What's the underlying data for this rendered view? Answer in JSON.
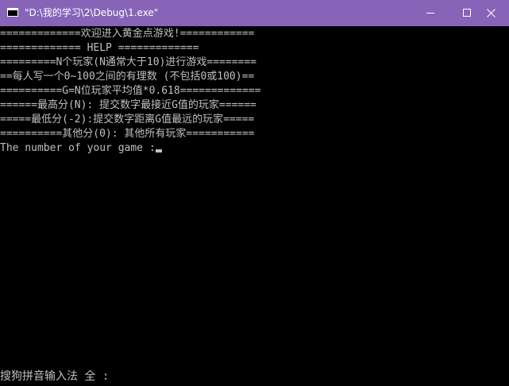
{
  "window": {
    "title": "\"D:\\我的学习\\2\\Debug\\1.exe\"",
    "controls": {
      "minimize": "minimize",
      "maximize": "maximize",
      "close": "close"
    },
    "colors": {
      "titlebar": "#8764b8",
      "console_background": "#000000",
      "console_text": "#c0c0c0"
    }
  },
  "console": {
    "lines": [
      "=============欢迎进入黄金点游戏!============",
      "============= HELP =============",
      "=========N个玩家(N通常大于10)进行游戏========",
      "==每人写一个0~100之间的有理数 (不包括0或100)==",
      "==========G=N位玩家平均值*0.618=============",
      "======最高分(N): 提交数字最接近G值的玩家======",
      "=====最低分(-2):提交数字距离G值最远的玩家=====",
      "==========其他分(0): 其他所有玩家===========",
      "The number of your game :"
    ]
  },
  "ime": {
    "status": "搜狗拼音输入法 全 :"
  }
}
